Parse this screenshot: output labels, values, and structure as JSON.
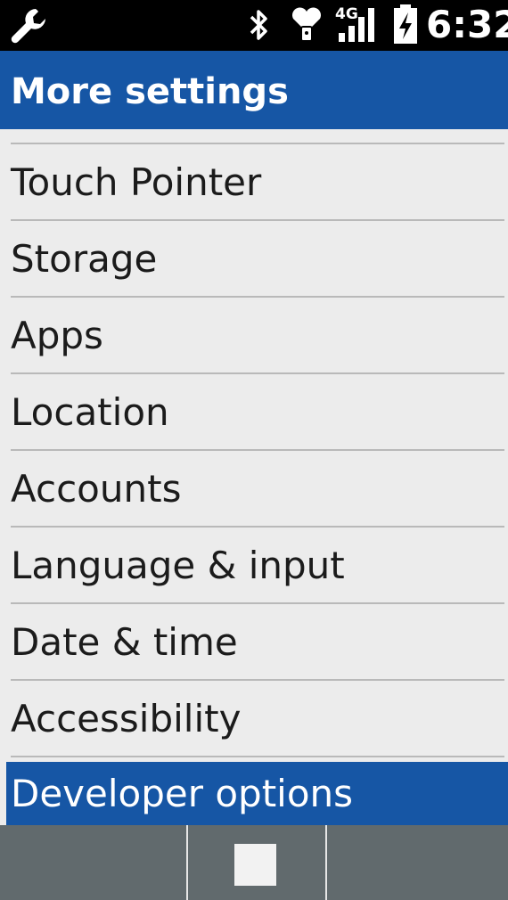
{
  "status_bar": {
    "icons": [
      "wrench-icon",
      "bluetooth-icon",
      "heart-lock-icon",
      "4g-signal-icon",
      "battery-charging-icon"
    ],
    "network_label": "4G",
    "time": "6:32"
  },
  "header": {
    "title": "More settings"
  },
  "settings_list": {
    "items": [
      {
        "label": "Touch Pointer"
      },
      {
        "label": "Storage"
      },
      {
        "label": "Apps"
      },
      {
        "label": "Location"
      },
      {
        "label": "Accounts"
      },
      {
        "label": "Language & input"
      },
      {
        "label": "Date & time"
      },
      {
        "label": "Accessibility"
      },
      {
        "label": "Developer options",
        "selected": true
      }
    ]
  },
  "softkeys": {
    "center_icon": "stop-square-icon"
  },
  "colors": {
    "status_bar_bg": "#000000",
    "accent": "#1656a5",
    "list_bg": "#ececec",
    "softkey_bg": "#616a6d"
  }
}
